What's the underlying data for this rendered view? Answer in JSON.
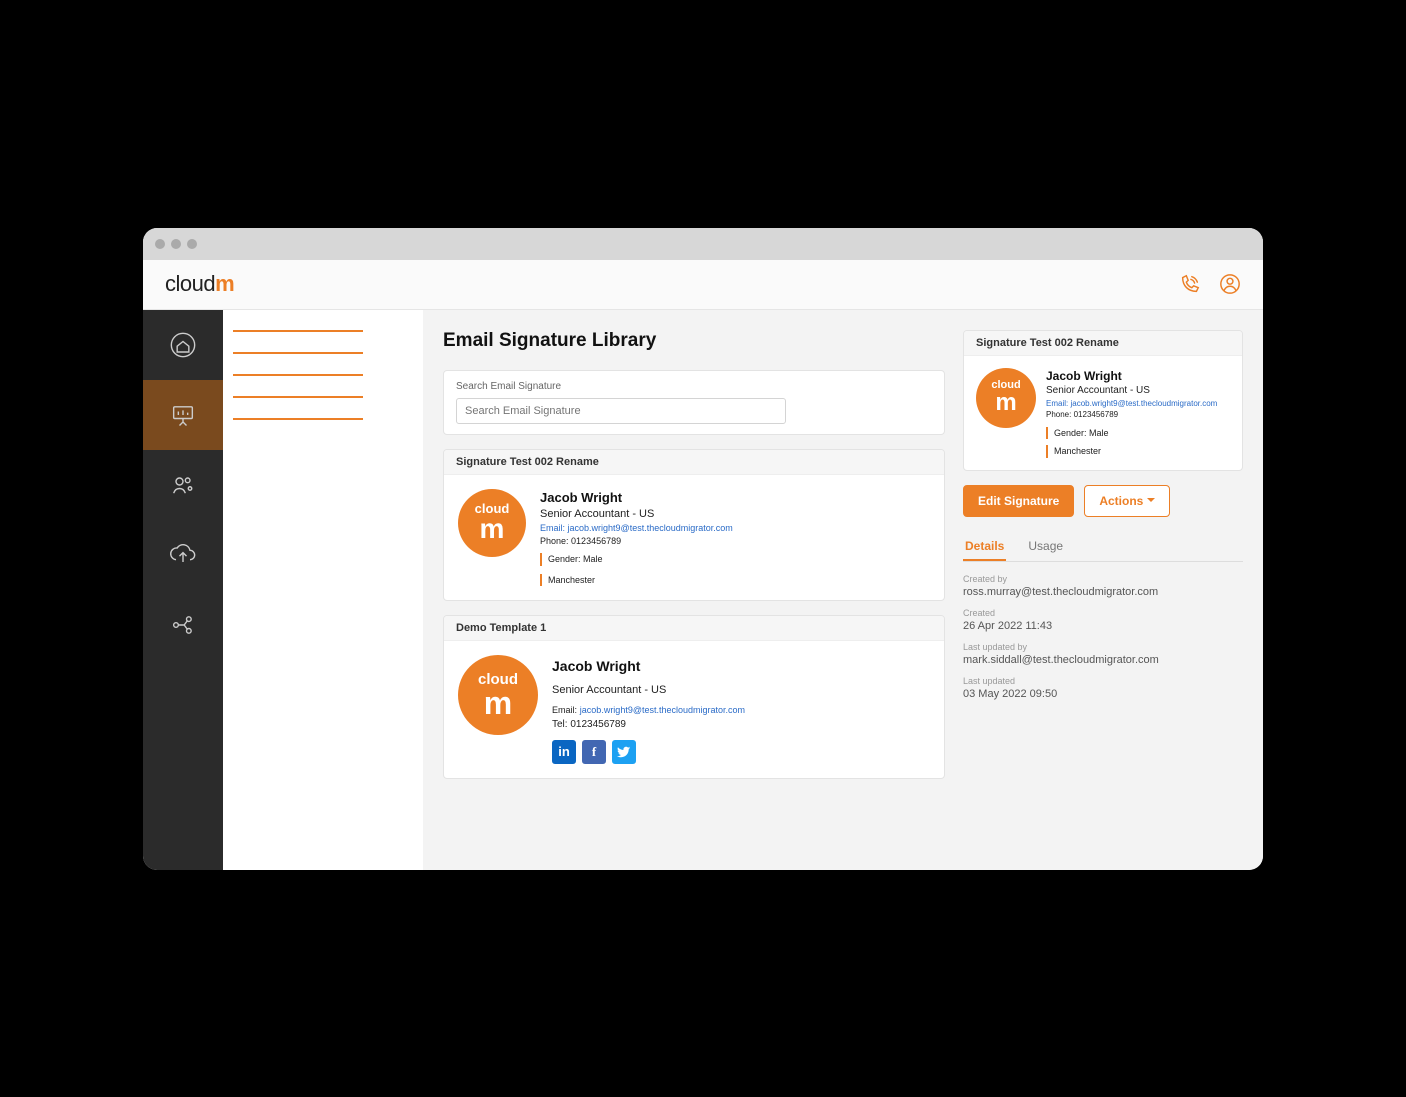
{
  "brand": {
    "part1": "cloud",
    "part2": "m"
  },
  "page": {
    "title": "Email Signature Library",
    "search_label": "Search Email Signature",
    "search_placeholder": "Search Email Signature"
  },
  "signatures": [
    {
      "title": "Signature Test 002 Rename",
      "name": "Jacob Wright",
      "role": "Senior Accountant - US",
      "email_label": "Email:",
      "email": "jacob.wright9@test.thecloudmigrator.com",
      "phone_label": "Phone:",
      "phone": "0123456789",
      "gender_label": "Gender:",
      "gender": "Male",
      "location": "Manchester"
    },
    {
      "title": "Demo Template 1",
      "name": "Jacob Wright",
      "role": "Senior Accountant - US",
      "email_label": "Email:",
      "email": "jacob.wright9@test.thecloudmigrator.com",
      "tel_label": "Tel:",
      "tel": "0123456789"
    }
  ],
  "preview": {
    "title": "Signature Test 002 Rename",
    "name": "Jacob Wright",
    "role": "Senior Accountant - US",
    "email_label": "Email:",
    "email": "jacob.wright9@test.thecloudmigrator.com",
    "phone_label": "Phone:",
    "phone": "0123456789",
    "gender_label": "Gender:",
    "gender": "Male",
    "location": "Manchester"
  },
  "actions": {
    "edit": "Edit Signature",
    "actions": "Actions"
  },
  "tabs": {
    "details": "Details",
    "usage": "Usage"
  },
  "meta": {
    "created_by_label": "Created by",
    "created_by": "ross.murray@test.thecloudmigrator.com",
    "created_label": "Created",
    "created": "26 Apr 2022 11:43",
    "updated_by_label": "Last updated by",
    "updated_by": "mark.siddall@test.thecloudmigrator.com",
    "updated_label": "Last updated",
    "updated": "03 May 2022 09:50"
  },
  "colors": {
    "accent": "#ec7f26"
  }
}
